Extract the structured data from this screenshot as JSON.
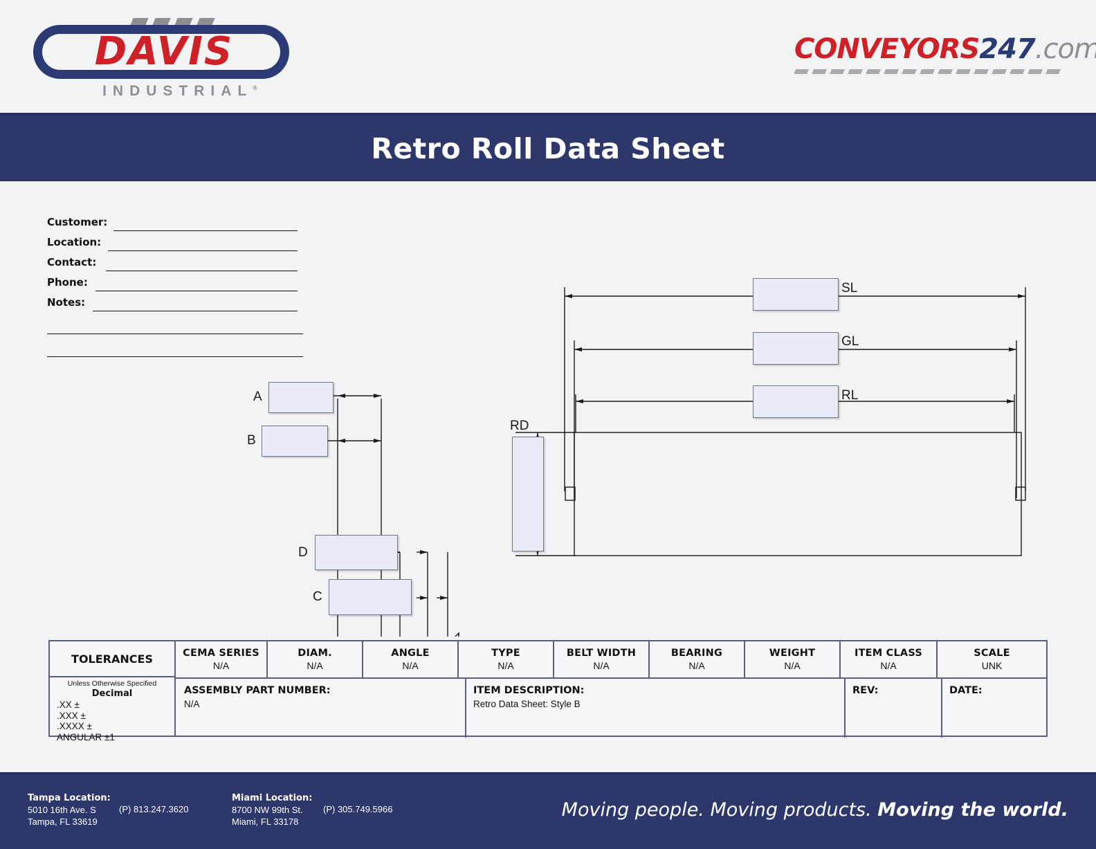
{
  "header": {
    "brand_logo": {
      "word": "DAVIS",
      "subtitle": "INDUSTRIAL",
      "registered_mark": "®"
    },
    "site_logo": {
      "part1": "CONVEYORS",
      "part2": "247",
      "part3": ".com"
    }
  },
  "banner": {
    "title": "Retro Roll Data Sheet"
  },
  "form": {
    "fields": [
      {
        "label": "Customer:",
        "value": ""
      },
      {
        "label": "Location:",
        "value": ""
      },
      {
        "label": "Contact:",
        "value": ""
      },
      {
        "label": "Phone:",
        "value": ""
      },
      {
        "label": "Notes:",
        "value": ""
      }
    ],
    "extra_blank_lines": 2
  },
  "drawing": {
    "dimension_labels": {
      "a": "A",
      "b": "B",
      "c": "C",
      "d": "D",
      "sl": "SL",
      "gl": "GL",
      "rl": "RL",
      "rd": "RD"
    },
    "input_values": {
      "a": "",
      "b": "",
      "c": "",
      "d": "",
      "sl": "",
      "gl": "",
      "rl": "",
      "rd": ""
    }
  },
  "title_block": {
    "tolerances": {
      "heading": "TOLERANCES",
      "subheading": "Unless Otherwise Specified",
      "decimal_label": "Decimal",
      "rows": [
        ".XX ±",
        ".XXX ±",
        ".XXXX ±",
        "ANGULAR ±1"
      ]
    },
    "columns": [
      {
        "header": "CEMA SERIES",
        "value": "N/A"
      },
      {
        "header": "DIAM.",
        "value": "N/A"
      },
      {
        "header": "ANGLE",
        "value": "N/A"
      },
      {
        "header": "TYPE",
        "value": "N/A"
      },
      {
        "header": "BELT WIDTH",
        "value": "N/A"
      },
      {
        "header": "BEARING",
        "value": "N/A"
      },
      {
        "header": "WEIGHT",
        "value": "N/A"
      },
      {
        "header": "ITEM CLASS",
        "value": "N/A"
      },
      {
        "header": "SCALE",
        "value": "UNK"
      }
    ],
    "assembly_part_number": {
      "label": "ASSEMBLY PART NUMBER:",
      "value": "N/A"
    },
    "item_description": {
      "label": "ITEM DESCRIPTION:",
      "value": "Retro Data Sheet: Style B"
    },
    "rev": {
      "label": "REV:",
      "value": ""
    },
    "date": {
      "label": "DATE:",
      "value": ""
    }
  },
  "footer": {
    "tampa": {
      "title": "Tampa Location:",
      "address1": "5010 16th Ave. S",
      "address2": "Tampa, FL 33619",
      "phone": "(P) 813.247.3620"
    },
    "miami": {
      "title": "Miami Location:",
      "address1": "8700 NW 99th St.",
      "address2": "Miami, FL 33178",
      "phone": "(P) 305.749.5966"
    },
    "tagline_regular": "Moving people. Moving products. ",
    "tagline_bold": "Moving the world."
  },
  "colors": {
    "navy": "#2e376b",
    "red": "#cf2027",
    "gray": "#8d8f94",
    "input_fill": "#e8ecf6",
    "page_bg": "#f2f3f5"
  }
}
